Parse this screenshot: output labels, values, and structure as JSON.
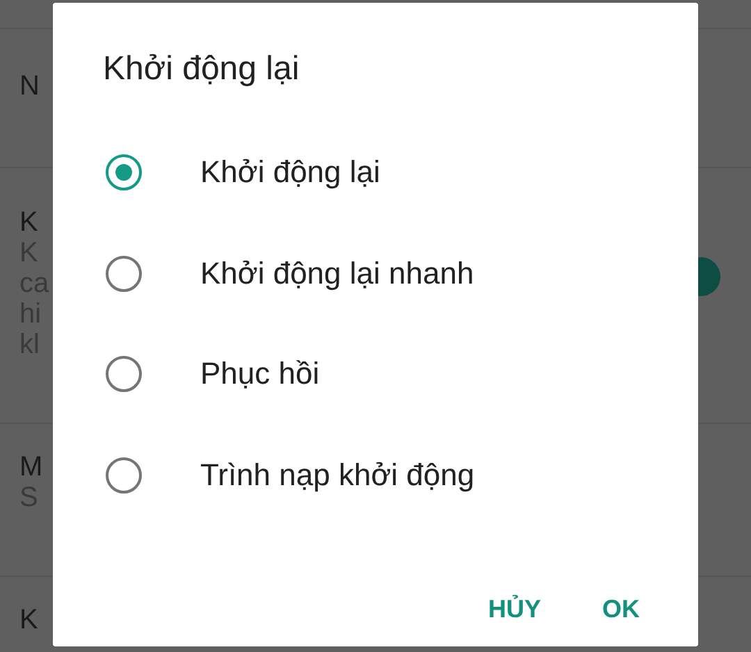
{
  "background_list": {
    "rows": [
      {
        "lines": [
          "N"
        ]
      },
      {
        "lines": [
          "K",
          "K",
          "ca",
          "hi",
          "kl"
        ],
        "switch_on": true
      },
      {
        "lines": [
          "M",
          "S"
        ]
      },
      {
        "lines": [
          "K"
        ]
      }
    ]
  },
  "dialog": {
    "title": "Khởi động lại",
    "options": [
      {
        "label": "Khởi động lại",
        "selected": true
      },
      {
        "label": "Khởi động lại nhanh",
        "selected": false
      },
      {
        "label": "Phục hồi",
        "selected": false
      },
      {
        "label": "Trình nạp khởi động",
        "selected": false
      }
    ],
    "buttons": [
      "HỦY",
      "OK"
    ]
  }
}
